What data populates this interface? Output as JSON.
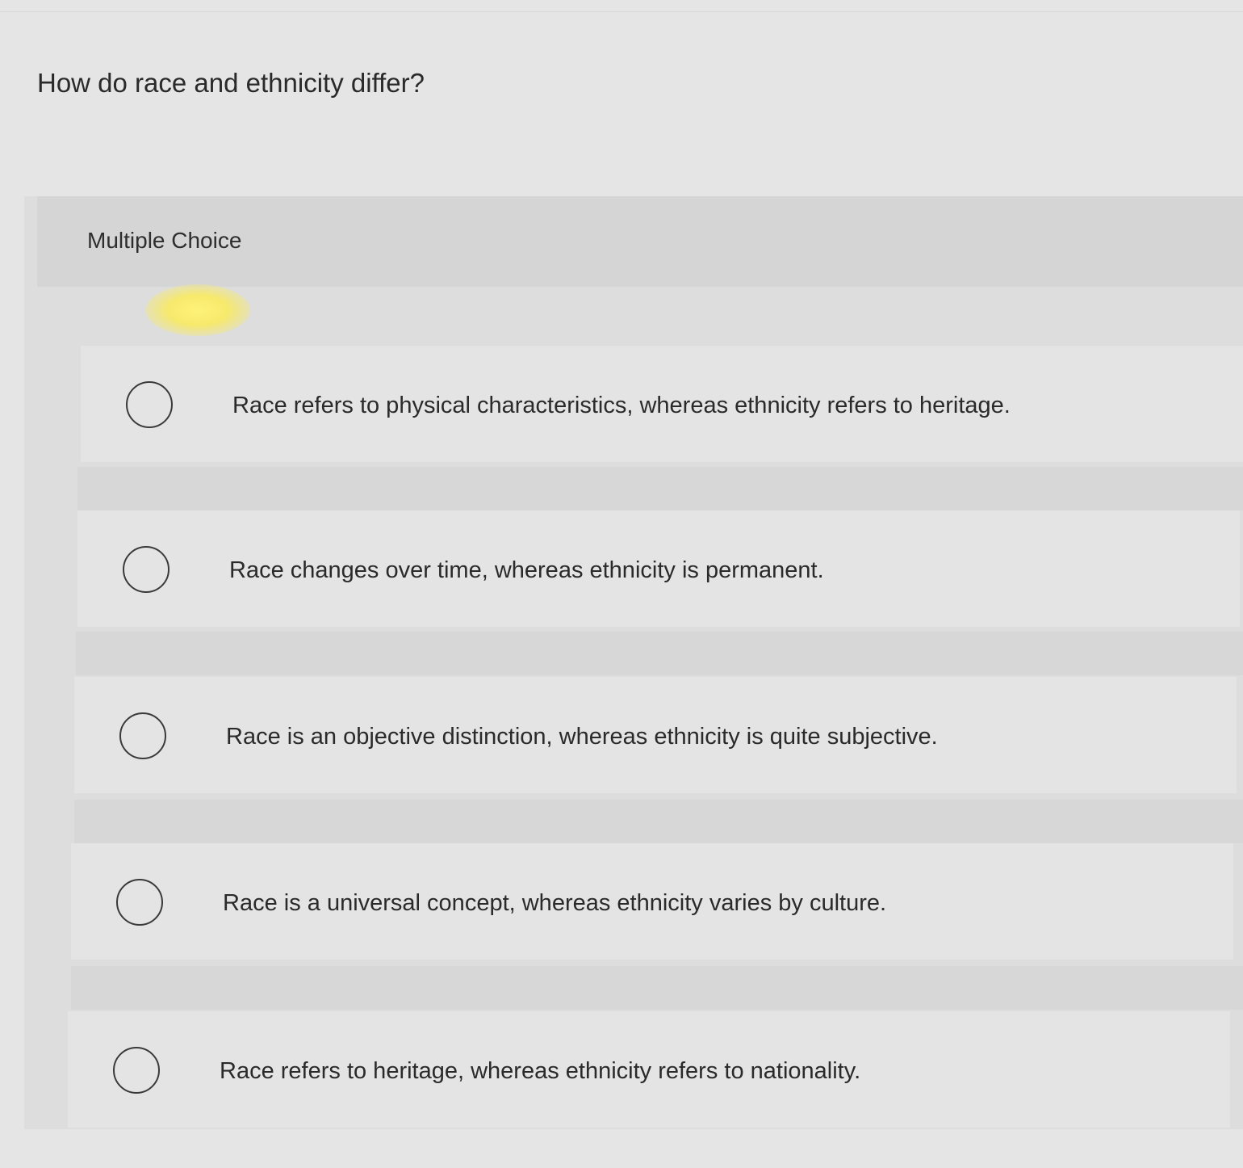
{
  "question": {
    "text": "How do race and ethnicity differ?"
  },
  "panel": {
    "type_label": "Multiple Choice"
  },
  "options": [
    {
      "label": "Race refers to physical characteristics, whereas ethnicity refers to heritage.",
      "selected": false
    },
    {
      "label": "Race changes over time, whereas ethnicity is permanent.",
      "selected": false
    },
    {
      "label": "Race is an objective distinction, whereas ethnicity is quite subjective.",
      "selected": false
    },
    {
      "label": "Race is a universal concept, whereas ethnicity varies by culture.",
      "selected": false
    },
    {
      "label": "Race refers to heritage, whereas ethnicity refers to nationality.",
      "selected": false
    }
  ],
  "colors": {
    "page_background": "#e4e5e4",
    "panel_background": "#dcdddc",
    "option_background": "#e3e4e3",
    "text": "#2a2a2a"
  }
}
